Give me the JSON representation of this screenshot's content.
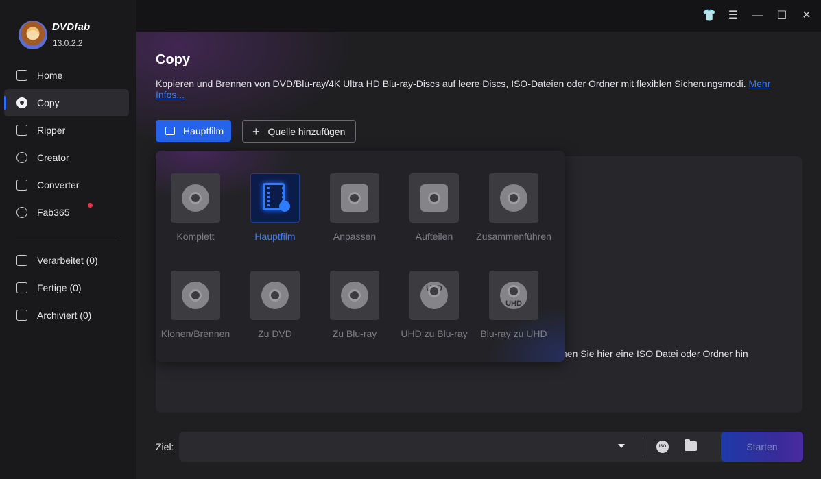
{
  "app": {
    "brand": "DVDfab",
    "version": "13.0.2.2"
  },
  "sidebar": {
    "items": [
      {
        "label": "Home",
        "icon": "home-icon"
      },
      {
        "label": "Copy",
        "icon": "copy-disc-icon",
        "active": true
      },
      {
        "label": "Ripper",
        "icon": "ripper-icon"
      },
      {
        "label": "Creator",
        "icon": "creator-icon"
      },
      {
        "label": "Converter",
        "icon": "converter-icon"
      },
      {
        "label": "Fab365",
        "icon": "fab365-icon",
        "badge": true
      }
    ],
    "queue": [
      {
        "label": "Verarbeitet (0)",
        "icon": "processing-icon"
      },
      {
        "label": "Fertige (0)",
        "icon": "finished-icon"
      },
      {
        "label": "Archiviert (0)",
        "icon": "archive-icon"
      }
    ],
    "badge_color": "#e8354a",
    "accent_color": "#2f6cf5"
  },
  "titlebar": {
    "icons": [
      "shirt-skin-icon",
      "menu-icon",
      "minimize-icon",
      "maximize-icon",
      "close-icon"
    ]
  },
  "main": {
    "title": "Copy",
    "description": "Kopieren und Brennen von DVD/Blu-ray/4K Ultra HD Blu-ray-Discs auf leere Discs, ISO-Dateien oder Ordner mit flexiblen Sicherungsmodi.",
    "more_link": "Mehr Infos...",
    "mode_button": "Hauptfilm",
    "add_source_button": "Quelle hinzufügen",
    "drop_hint": "hen Sie hier eine ISO Datei oder Ordner hin",
    "modes": [
      {
        "label": "Komplett",
        "icon": "disc-icon"
      },
      {
        "label": "Hauptfilm",
        "icon": "film-icon",
        "active": true
      },
      {
        "label": "Anpassen",
        "icon": "edit-icon"
      },
      {
        "label": "Aufteilen",
        "icon": "split-crop-icon"
      },
      {
        "label": "Zusammenführen",
        "icon": "merge-link-icon"
      },
      {
        "label": "Klonen/Brennen",
        "icon": "burn-flame-icon"
      },
      {
        "label": "Zu DVD",
        "icon": "bluray-to-dvd-icon"
      },
      {
        "label": "Zu Blu-ray",
        "icon": "to-bluray-icon"
      },
      {
        "label": "UHD zu Blu-ray",
        "icon": "uhd-to-bluray-icon",
        "badge_text": "UHD"
      },
      {
        "label": "Blu-ray zu UHD",
        "icon": "bluray-to-uhd-icon",
        "badge_text": "UHD"
      }
    ]
  },
  "bottom": {
    "target_label": "Ziel:",
    "target_value": "",
    "iso_label": "ISO",
    "start_button": "Starten"
  }
}
